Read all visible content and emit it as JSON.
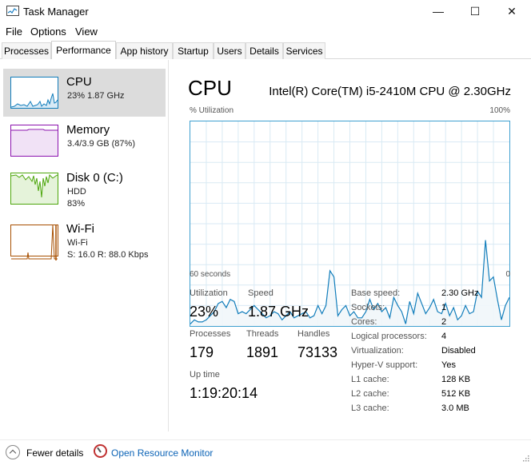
{
  "window": {
    "title": "Task Manager",
    "minimize_glyph": "—",
    "maximize_glyph": "☐",
    "close_glyph": "✕"
  },
  "menu": [
    "File",
    "Options",
    "View"
  ],
  "tabs": [
    "Processes",
    "Performance",
    "App history",
    "Startup",
    "Users",
    "Details",
    "Services"
  ],
  "active_tab": "Performance",
  "sidebar": {
    "items": [
      {
        "title": "CPU",
        "line1": "23%  1.87 GHz",
        "line2": "",
        "color": "#117dbb",
        "selected": true
      },
      {
        "title": "Memory",
        "line1": "3.4/3.9 GB (87%)",
        "line2": "",
        "color": "#8b12ae",
        "selected": false
      },
      {
        "title": "Disk 0 (C:)",
        "line1": "HDD",
        "line2": "83%",
        "color": "#4da60c",
        "selected": false
      },
      {
        "title": "Wi-Fi",
        "line1": "Wi-Fi",
        "line2": "S: 16.0  R: 88.0 Kbps",
        "color": "#a74f01",
        "selected": false
      }
    ]
  },
  "main": {
    "title": "CPU",
    "cpu_name": "Intel(R) Core(TM) i5-2410M CPU @ 2.30GHz",
    "graph": {
      "ylabel": "% Utilization",
      "ymax_label": "100%",
      "xlabel_left": "60 seconds",
      "xlabel_right": "0",
      "line_color": "#117dbb",
      "fill_color": "#f1f6fa",
      "grid_color": "#d9eaf4"
    },
    "stats": {
      "utilization_label": "Utilization",
      "utilization_value": "23%",
      "speed_label": "Speed",
      "speed_value": "1.87 GHz",
      "processes_label": "Processes",
      "processes_value": "179",
      "threads_label": "Threads",
      "threads_value": "1891",
      "handles_label": "Handles",
      "handles_value": "73133",
      "uptime_label": "Up time",
      "uptime_value": "1:19:20:14"
    },
    "specs": [
      {
        "label": "Base speed:",
        "value": "2.30 GHz"
      },
      {
        "label": "Sockets:",
        "value": "1"
      },
      {
        "label": "Cores:",
        "value": "2"
      },
      {
        "label": "Logical processors:",
        "value": "4"
      },
      {
        "label": "Virtualization:",
        "value": "Disabled"
      },
      {
        "label": "Hyper-V support:",
        "value": "Yes"
      },
      {
        "label": "L1 cache:",
        "value": "128 KB"
      },
      {
        "label": "L2 cache:",
        "value": "512 KB"
      },
      {
        "label": "L3 cache:",
        "value": "3.0 MB"
      }
    ]
  },
  "footer": {
    "fewer_details": "Fewer details",
    "open_resource_monitor": "Open Resource Monitor"
  },
  "chart_data": {
    "type": "area",
    "title": "CPU",
    "ylabel": "% Utilization",
    "xlabel": "60 seconds",
    "x_range_seconds": [
      60,
      0
    ],
    "ylim": [
      0,
      100
    ],
    "grid": true,
    "series": [
      {
        "values": [
          1,
          3,
          2,
          2,
          3,
          5,
          7,
          11,
          12,
          9,
          13,
          12,
          6,
          7,
          6,
          8,
          10,
          8,
          6,
          4,
          5,
          7,
          6,
          3,
          5,
          7,
          4,
          5,
          6,
          7,
          4,
          5,
          10,
          6,
          10,
          27,
          24,
          5,
          8,
          10,
          5,
          7,
          4,
          4,
          7,
          13,
          8,
          11,
          7,
          9,
          4,
          14,
          10,
          7,
          1,
          12,
          6,
          16,
          11,
          6,
          9,
          13,
          7,
          6,
          11,
          5,
          9,
          3,
          5,
          10,
          6,
          7,
          17,
          14,
          42,
          22,
          24,
          13,
          3,
          10,
          14
        ]
      }
    ]
  }
}
